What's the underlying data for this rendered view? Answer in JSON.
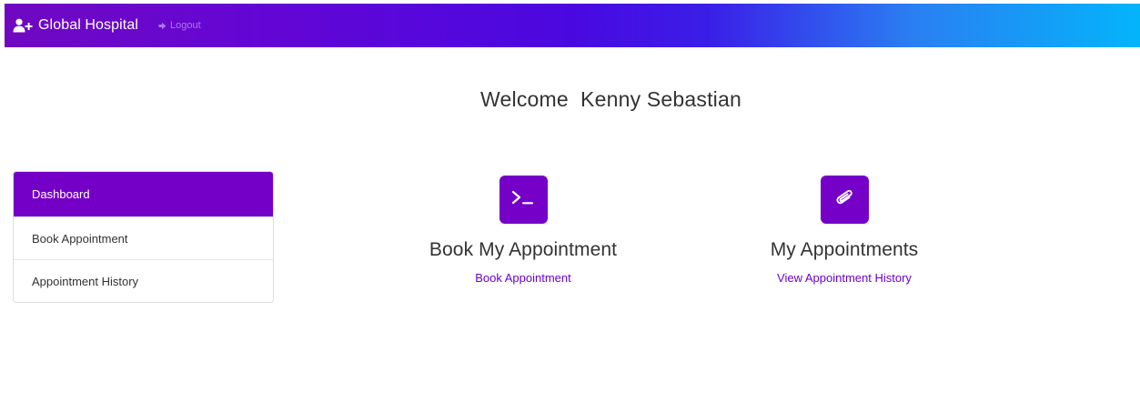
{
  "navbar": {
    "brand_icon": "user-plus-icon",
    "brand_label": "Global Hospital",
    "logout_icon": "sign-out-icon",
    "logout_label": "Logout",
    "gradient_colors": [
      "#7008c2",
      "#4a08e0",
      "#04b4fb"
    ]
  },
  "welcome": {
    "text": "Welcome  Kenny Sebastian"
  },
  "sidebar": {
    "active_color": "#7400c7",
    "items": [
      {
        "label": "Dashboard",
        "active": true
      },
      {
        "label": "Book Appointment",
        "active": false
      },
      {
        "label": "Appointment History",
        "active": false
      }
    ]
  },
  "cards": [
    {
      "icon": "terminal-icon",
      "title": "Book My Appointment",
      "link": "Book Appointment"
    },
    {
      "icon": "paperclip-icon",
      "title": "My Appointments",
      "link": "View Appointment History"
    }
  ],
  "accent_color": "#7500c8"
}
